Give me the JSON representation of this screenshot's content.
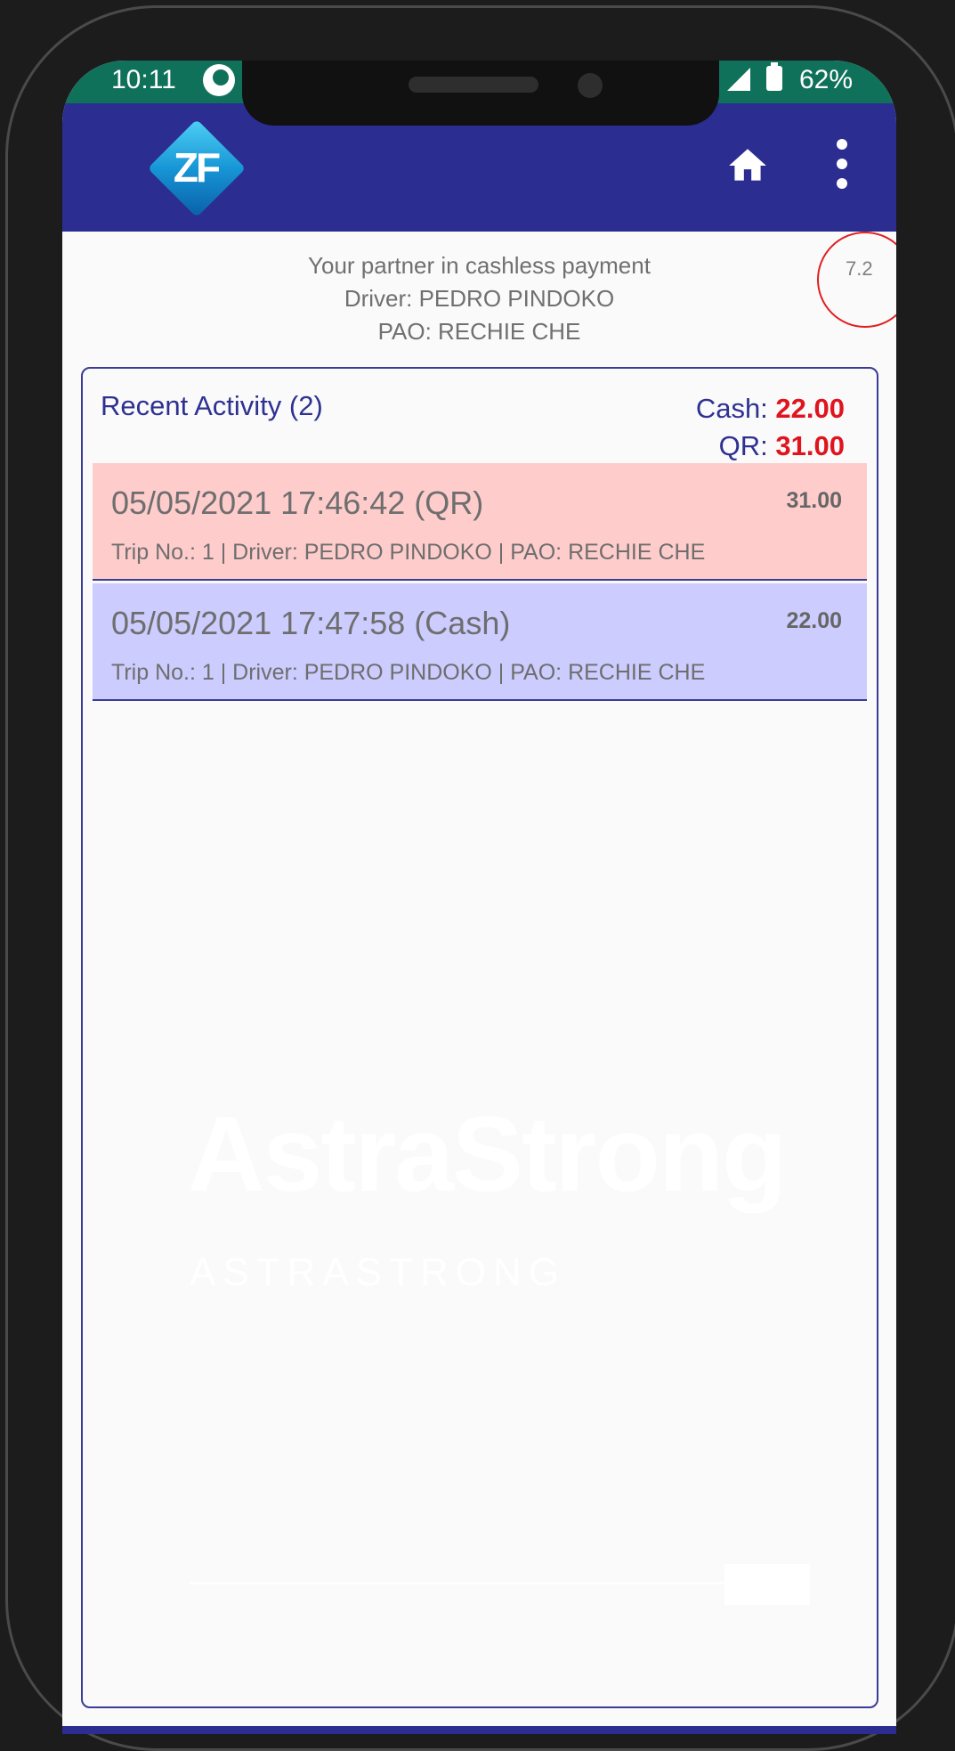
{
  "status_bar": {
    "time": "10:11",
    "battery": "62%",
    "app_icon": "app-notification-icon",
    "signal_icon": "cell-signal-icon",
    "battery_icon": "battery-icon"
  },
  "app_bar": {
    "logo_text": "ZF",
    "home_icon": "home-icon",
    "menu_icon": "more-vertical-icon",
    "background_color": "#2b2d91"
  },
  "header": {
    "tagline": "Your partner in cashless payment",
    "driver": "Driver: PEDRO PINDOKO",
    "pao": "PAO: RECHIE CHE",
    "version": "7.2"
  },
  "recent_activity": {
    "title": "Recent Activity (2)",
    "cash_label": "Cash:",
    "cash_total": "22.00",
    "qr_label": "QR:",
    "qr_total": "31.00",
    "items": [
      {
        "datetime": "05/05/2021 17:46:42 (QR)",
        "amount": "31.00",
        "details": "Trip No.: 1 | Driver: PEDRO PINDOKO | PAO: RECHIE CHE",
        "color": "#ffcccc"
      },
      {
        "datetime": "05/05/2021 17:47:58 (Cash)",
        "amount": "22.00",
        "details": "Trip No.: 1 | Driver: PEDRO PINDOKO | PAO: RECHIE CHE",
        "color": "#ccccff"
      }
    ]
  },
  "watermark": {
    "title": "AstraStrong",
    "subtitle": "ASTRASTRONG"
  },
  "colors": {
    "accent": "#2e3192",
    "amount_red": "#e0141e",
    "status_bar": "#10715b"
  }
}
